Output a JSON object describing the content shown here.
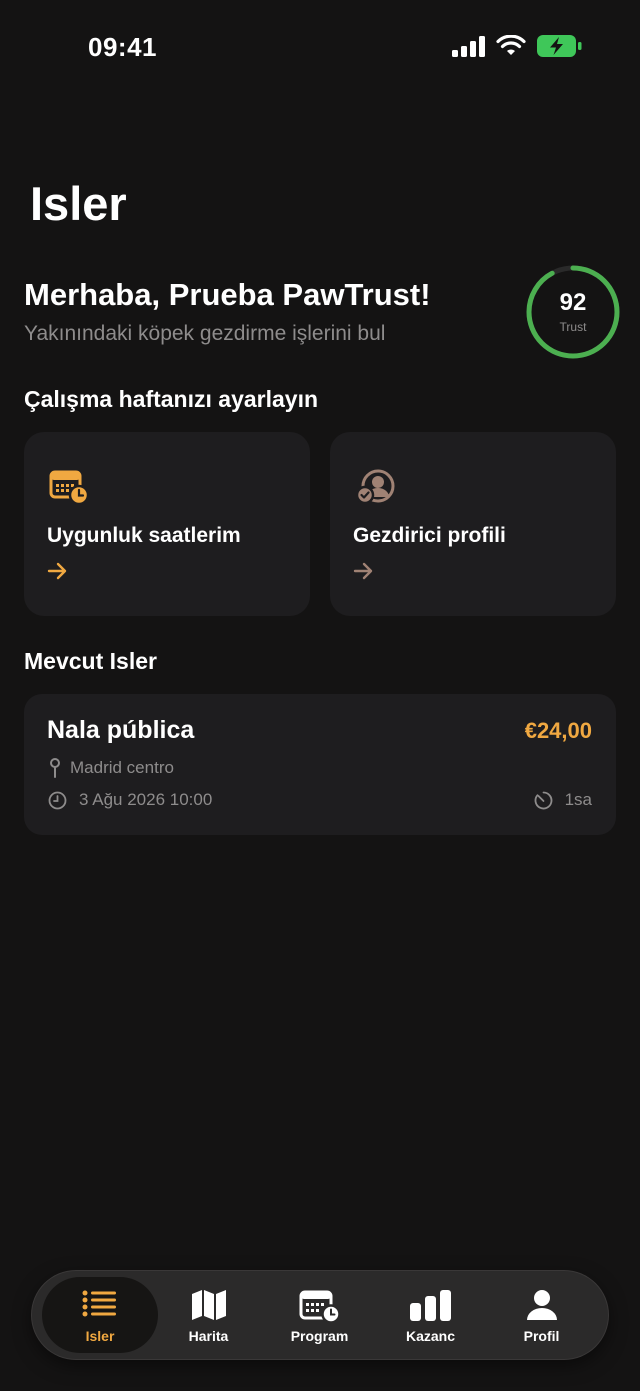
{
  "status_bar": {
    "time": "09:41"
  },
  "page_title": "Isler",
  "greeting": {
    "title": "Merhaba, Prueba PawTrust!",
    "subtitle": "Yakınındaki köpek gezdirme işlerini bul"
  },
  "trust": {
    "score": "92",
    "label": "Trust",
    "level": 0.92,
    "color": "#4caf50"
  },
  "week_section": {
    "title": "Çalışma haftanızı ayarlayın",
    "cards": [
      {
        "label": "Uygunluk saatlerim",
        "icon": "calendar-clock-icon",
        "accent": "#f0a841"
      },
      {
        "label": "Gezdirici profili",
        "icon": "user-check-icon",
        "accent": "#a08274"
      }
    ]
  },
  "jobs_section": {
    "title": "Mevcut Isler",
    "jobs": [
      {
        "title": "Nala pública",
        "price": "€24,00",
        "location": "Madrid centro",
        "datetime": "3 Ağu 2026 10:00",
        "duration": "1sa"
      }
    ]
  },
  "tab_bar": {
    "active": "Isler",
    "tabs": [
      {
        "label": "Isler",
        "icon": "list-icon"
      },
      {
        "label": "Harita",
        "icon": "map-icon"
      },
      {
        "label": "Program",
        "icon": "calendar-icon"
      },
      {
        "label": "Kazanc",
        "icon": "bar-chart-icon"
      },
      {
        "label": "Profil",
        "icon": "person-icon"
      }
    ]
  },
  "colors": {
    "background": "#141313",
    "card": "#1e1d1f",
    "accent": "#f0a841",
    "muted_text": "#8e8c8c"
  }
}
